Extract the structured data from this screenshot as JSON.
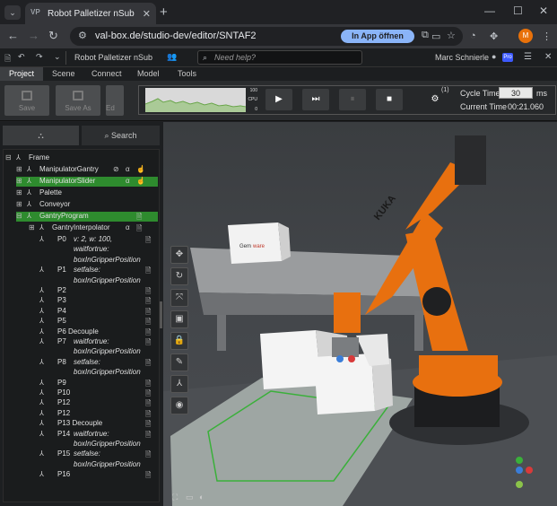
{
  "browser": {
    "tab_title": "Robot Palletizer nSub",
    "tab_fav": "VP",
    "url": "val-box.de/studio-dev/editor/SNTAF2",
    "in_app_label": "In App öffnen",
    "profile_initial": "M"
  },
  "app": {
    "title": "Robot Palletizer nSub",
    "help_placeholder": "Need help?",
    "user_name": "Marc Schnierle",
    "pro_badge": "Pro",
    "menu": [
      "Project",
      "Scene",
      "Connect",
      "Model",
      "Tools"
    ],
    "toolbar": {
      "save": "Save",
      "save_as": "Save As",
      "edit": "Ed"
    }
  },
  "sim": {
    "chart_ticks": [
      "100",
      "CPU",
      "0"
    ],
    "cycle_time_label": "Cycle Time",
    "cycle_time_value": "30",
    "cycle_time_unit": "ms",
    "current_time_label": "Current Time",
    "current_time_value": "00:21.060",
    "robot_badge": "(1)"
  },
  "panel": {
    "tabs": [
      "",
      "Search"
    ],
    "tree": [
      {
        "label": "Frame"
      },
      {
        "label": "ManipulatorGantry"
      },
      {
        "label": "ManipulatorSlider"
      },
      {
        "label": "Palette"
      },
      {
        "label": "Conveyor"
      },
      {
        "label": "GantryProgram"
      },
      {
        "label": "GantryInterpolator"
      }
    ],
    "program": [
      {
        "label": "P0",
        "detail": "v: 2, w: 100,"
      },
      {
        "label": "",
        "detail": "waitfortrue:"
      },
      {
        "label": "",
        "detail": "boxInGripperPosition"
      },
      {
        "label": "P1",
        "detail": "setfalse:"
      },
      {
        "label": "",
        "detail": "boxInGripperPosition"
      },
      {
        "label": "P2",
        "detail": ""
      },
      {
        "label": "P3",
        "detail": ""
      },
      {
        "label": "P4",
        "detail": ""
      },
      {
        "label": "P5",
        "detail": ""
      },
      {
        "label": "P6 Decouple",
        "detail": ""
      },
      {
        "label": "P7",
        "detail": "waitfortrue:"
      },
      {
        "label": "",
        "detail": "boxInGripperPosition"
      },
      {
        "label": "P8",
        "detail": "setfalse:"
      },
      {
        "label": "",
        "detail": "boxInGripperPosition"
      },
      {
        "label": "P9",
        "detail": ""
      },
      {
        "label": "P10",
        "detail": ""
      },
      {
        "label": "P12",
        "detail": ""
      },
      {
        "label": "P12",
        "detail": ""
      },
      {
        "label": "P13 Decouple",
        "detail": ""
      },
      {
        "label": "P14",
        "detail": "waitfortrue:"
      },
      {
        "label": "",
        "detail": "boxInGripperPosition"
      },
      {
        "label": "P15",
        "detail": "setfalse:"
      },
      {
        "label": "",
        "detail": "boxInGripperPosition"
      },
      {
        "label": "P16",
        "detail": ""
      }
    ]
  },
  "scene": {
    "robot_brand": "KUKA",
    "box_brand_left": "Gem",
    "box_brand_right": "ware"
  },
  "colors": {
    "accent": "#2e8b2e",
    "robot_orange": "#e8700f",
    "chrome_blue": "#8ab4f8"
  }
}
